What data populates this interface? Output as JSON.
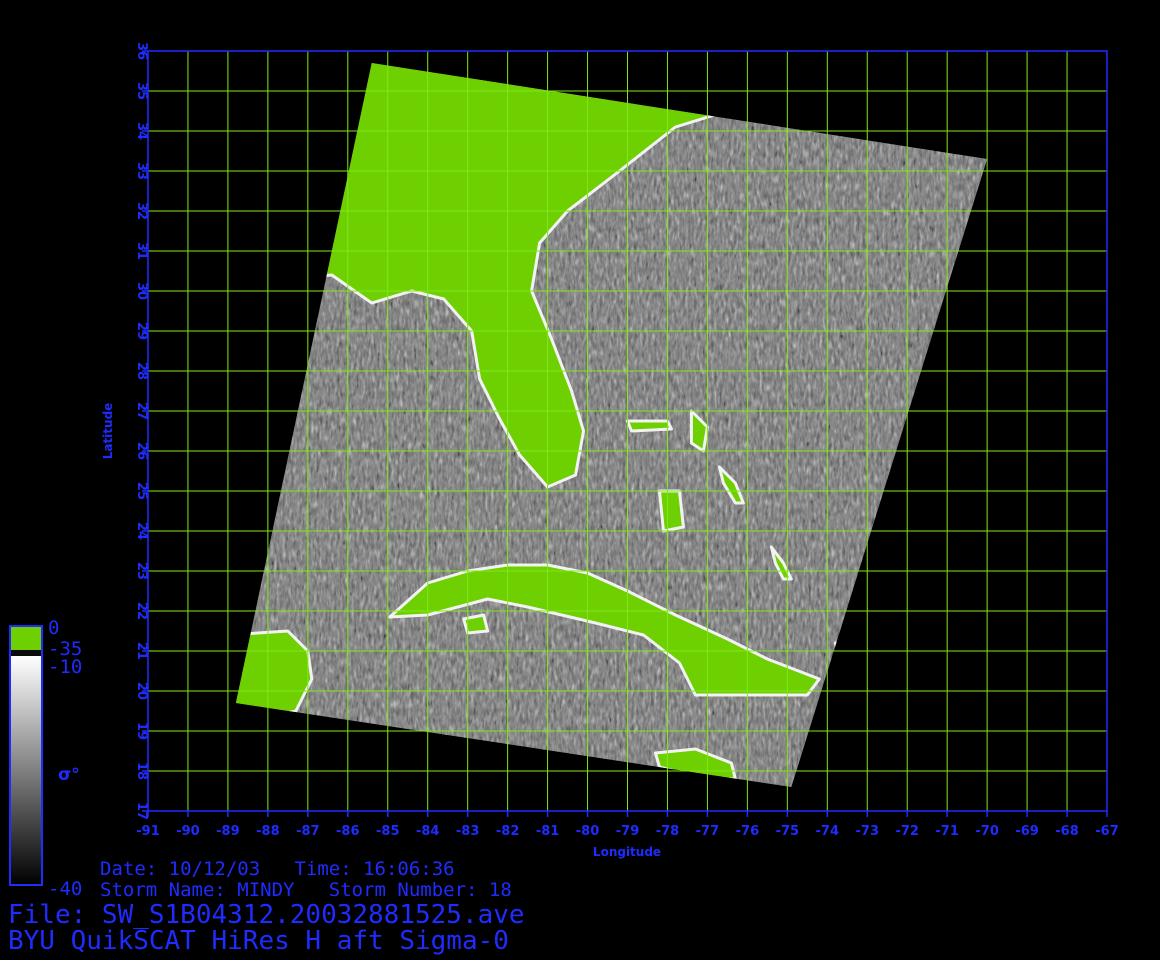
{
  "map": {
    "lon_range": [
      -91,
      -67
    ],
    "lat_range": [
      17,
      36
    ],
    "lon_ticks": [
      -91,
      -90,
      -89,
      -88,
      -87,
      -86,
      -85,
      -84,
      -83,
      -82,
      -81,
      -80,
      -79,
      -78,
      -77,
      -76,
      -75,
      -74,
      -73,
      -72,
      -71,
      -70,
      -69,
      -68,
      -67
    ],
    "lat_ticks": [
      17,
      18,
      19,
      20,
      21,
      22,
      23,
      24,
      25,
      26,
      27,
      28,
      29,
      30,
      31,
      32,
      33,
      34,
      35,
      36
    ],
    "xlabel": "Longitude",
    "ylabel": "Latitude",
    "grid_color": "#7fe81a",
    "frame_color": "#1e2cff",
    "land_color": "#6ed000",
    "swath_corners": [
      [
        -85.4,
        35.7
      ],
      [
        -70.0,
        33.3
      ],
      [
        -74.9,
        17.6
      ],
      [
        -88.8,
        19.7
      ]
    ]
  },
  "colorbar": {
    "top_value": "0",
    "land_value": "-35",
    "upper_value": "-10",
    "bottom_value": "-40",
    "symbol": "σ°",
    "land_color": "#6ed000",
    "border_color": "#1e2cff"
  },
  "info": {
    "date_line": "Date: 10/12/03   Time: 16:06:36",
    "storm_line": "Storm Name: MINDY   Storm Number: 18",
    "file_line": "File: SW_S1B04312.20032881525.ave",
    "product_line": "BYU QuikSCAT HiRes H aft Sigma-0"
  }
}
